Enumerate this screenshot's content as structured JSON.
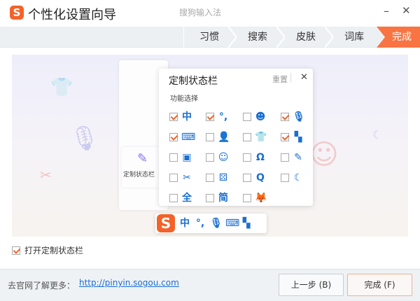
{
  "window": {
    "title": "个性化设置向导",
    "subtitle": "搜狗输入法",
    "logo": "S",
    "minimize": "–",
    "close": "✕"
  },
  "steps": [
    {
      "label": "习惯"
    },
    {
      "label": "搜索"
    },
    {
      "label": "皮肤"
    },
    {
      "label": "词库"
    },
    {
      "label": "完成",
      "active": true
    }
  ],
  "background_panel": {
    "item_label": "定制状态栏"
  },
  "popup": {
    "title": "定制状态栏",
    "reset": "重置",
    "close": "✕",
    "section": "功能选择",
    "items": [
      {
        "icon": "中",
        "name": "chinese-mode",
        "checked": true
      },
      {
        "icon": "°,",
        "name": "punctuation",
        "checked": true
      },
      {
        "icon": "☻",
        "name": "emoji",
        "checked": false
      },
      {
        "icon": "🎙",
        "name": "microphone",
        "checked": true
      },
      {
        "icon": "⌨",
        "name": "keyboard",
        "checked": true
      },
      {
        "icon": "👤",
        "name": "user",
        "checked": false
      },
      {
        "icon": "👕",
        "name": "skin",
        "checked": false
      },
      {
        "icon": "▚",
        "name": "toolbox",
        "checked": true
      },
      {
        "icon": "▣",
        "name": "clipboard",
        "checked": false
      },
      {
        "icon": "☺",
        "name": "emoticon",
        "checked": false
      },
      {
        "icon": "Ω",
        "name": "special-symbol",
        "checked": false
      },
      {
        "icon": "✎",
        "name": "handwriting",
        "checked": false
      },
      {
        "icon": "✂",
        "name": "screenshot",
        "checked": false
      },
      {
        "icon": "⚄",
        "name": "translate",
        "checked": false
      },
      {
        "icon": "Q",
        "name": "search",
        "checked": false
      },
      {
        "icon": "☾",
        "name": "night-mode",
        "checked": false
      },
      {
        "icon": "全",
        "name": "full-width",
        "checked": false
      },
      {
        "icon": "简",
        "name": "simplified",
        "checked": false
      },
      {
        "icon": "🦊",
        "name": "mascot",
        "checked": false
      }
    ]
  },
  "statusbar_preview": [
    "中",
    "°,",
    "🎙",
    "⌨",
    "▚"
  ],
  "open_statusbar": {
    "label": "打开定制状态栏",
    "checked": true
  },
  "footer": {
    "text": "去官网了解更多：",
    "link": "http://pinyin.sogou.com",
    "prev": "上一步 (B)",
    "finish": "完成 (F)"
  },
  "colors": {
    "accent": "#f87543",
    "icon_blue": "#1a6fd1"
  }
}
